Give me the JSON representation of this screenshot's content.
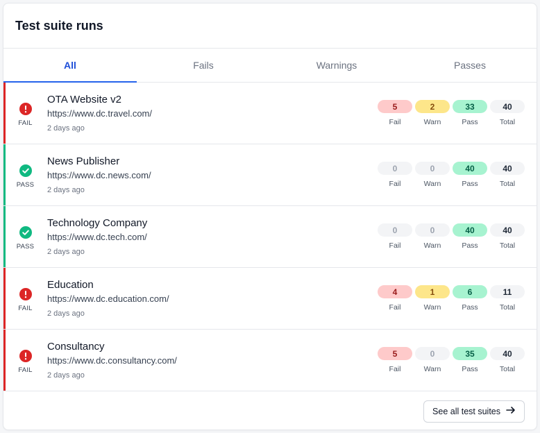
{
  "header": {
    "title": "Test suite runs"
  },
  "tabs": [
    {
      "label": "All",
      "active": true
    },
    {
      "label": "Fails",
      "active": false
    },
    {
      "label": "Warnings",
      "active": false
    },
    {
      "label": "Passes",
      "active": false
    }
  ],
  "stat_labels": {
    "fail": "Fail",
    "warn": "Warn",
    "pass": "Pass",
    "total": "Total"
  },
  "runs": [
    {
      "status": "fail",
      "status_label": "FAIL",
      "name": "OTA Website v2",
      "url": "https://www.dc.travel.com/",
      "time": "2 days ago",
      "fail": "5",
      "warn": "2",
      "pass": "33",
      "total": "40"
    },
    {
      "status": "pass",
      "status_label": "PASS",
      "name": "News Publisher",
      "url": "https://www.dc.news.com/",
      "time": "2 days ago",
      "fail": "0",
      "warn": "0",
      "pass": "40",
      "total": "40"
    },
    {
      "status": "pass",
      "status_label": "PASS",
      "name": "Technology Company",
      "url": "https://www.dc.tech.com/",
      "time": "2 days ago",
      "fail": "0",
      "warn": "0",
      "pass": "40",
      "total": "40"
    },
    {
      "status": "fail",
      "status_label": "FAIL",
      "name": "Education",
      "url": "https://www.dc.education.com/",
      "time": "2 days ago",
      "fail": "4",
      "warn": "1",
      "pass": "6",
      "total": "11"
    },
    {
      "status": "fail",
      "status_label": "FAIL",
      "name": "Consultancy",
      "url": "https://www.dc.consultancy.com/",
      "time": "2 days ago",
      "fail": "5",
      "warn": "0",
      "pass": "35",
      "total": "40"
    }
  ],
  "footer": {
    "see_all_label": "See all test suites"
  },
  "colors": {
    "fail": "#dc2626",
    "pass": "#10b981",
    "warn": "#fde68a",
    "accent": "#2563eb"
  }
}
